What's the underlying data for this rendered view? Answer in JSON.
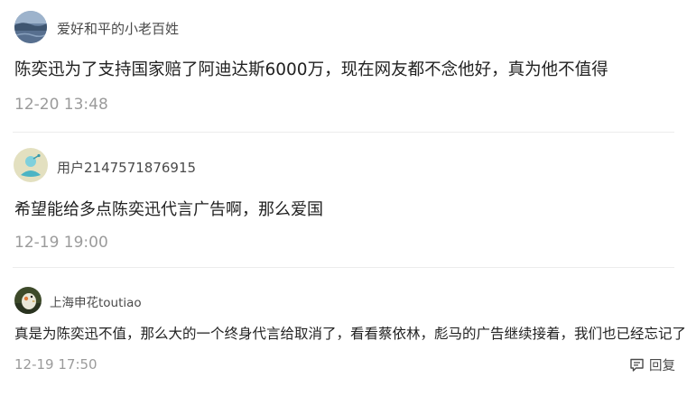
{
  "comments": [
    {
      "username": "爱好和平的小老百姓",
      "content": "陈奕迅为了支持国家赔了阿迪达斯6000万，现在网友都不念他好，真为他不值得",
      "time": "12-20 13:48"
    },
    {
      "username": "用户2147571876915",
      "content": "希望能给多点陈奕迅代言广告啊，那么爱国",
      "time": "12-19 19:00"
    },
    {
      "username": "上海申花toutiao",
      "content": "真是为陈奕迅不值，那么大的一个终身代言给取消了，看看蔡依林，彪马的广告继续接着，我们也已经忘记了",
      "time": "12-19 17:50",
      "reply_label": "回复"
    }
  ],
  "icons": {
    "reply": "comment-reply-icon"
  }
}
